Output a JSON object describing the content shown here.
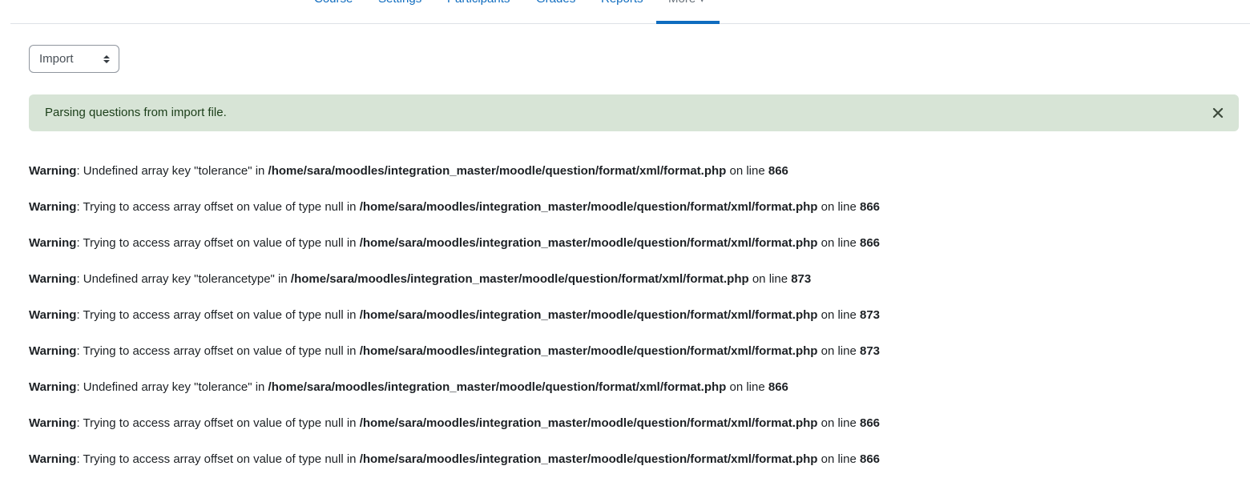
{
  "secondary_nav": {
    "tabs": [
      {
        "label": "Course"
      },
      {
        "label": "Settings"
      },
      {
        "label": "Participants"
      },
      {
        "label": "Grades"
      },
      {
        "label": "Reports"
      },
      {
        "label": "More ▾"
      }
    ],
    "active_tab": "More"
  },
  "question_bank_select": {
    "value": "Import",
    "icon": "sort-arrows-icon"
  },
  "alert": {
    "message": "Parsing questions from import file.",
    "close_icon": "close-icon",
    "background_color": "#d7e4d6"
  },
  "warnings": [
    {
      "label": "Warning",
      "text": ": Undefined array key \"tolerance\" in ",
      "file": "/home/sara/moodles/integration_master/moodle/question/format/xml/format.php",
      "mid": " on line ",
      "line": "866"
    },
    {
      "label": "Warning",
      "text": ": Trying to access array offset on value of type null in ",
      "file": "/home/sara/moodles/integration_master/moodle/question/format/xml/format.php",
      "mid": " on line ",
      "line": "866"
    },
    {
      "label": "Warning",
      "text": ": Trying to access array offset on value of type null in ",
      "file": "/home/sara/moodles/integration_master/moodle/question/format/xml/format.php",
      "mid": " on line ",
      "line": "866"
    },
    {
      "label": "Warning",
      "text": ": Undefined array key \"tolerancetype\" in ",
      "file": "/home/sara/moodles/integration_master/moodle/question/format/xml/format.php",
      "mid": " on line ",
      "line": "873"
    },
    {
      "label": "Warning",
      "text": ": Trying to access array offset on value of type null in ",
      "file": "/home/sara/moodles/integration_master/moodle/question/format/xml/format.php",
      "mid": " on line ",
      "line": "873"
    },
    {
      "label": "Warning",
      "text": ": Trying to access array offset on value of type null in ",
      "file": "/home/sara/moodles/integration_master/moodle/question/format/xml/format.php",
      "mid": " on line ",
      "line": "873"
    },
    {
      "label": "Warning",
      "text": ": Undefined array key \"tolerance\" in ",
      "file": "/home/sara/moodles/integration_master/moodle/question/format/xml/format.php",
      "mid": " on line ",
      "line": "866"
    },
    {
      "label": "Warning",
      "text": ": Trying to access array offset on value of type null in ",
      "file": "/home/sara/moodles/integration_master/moodle/question/format/xml/format.php",
      "mid": " on line ",
      "line": "866"
    },
    {
      "label": "Warning",
      "text": ": Trying to access array offset on value of type null in ",
      "file": "/home/sara/moodles/integration_master/moodle/question/format/xml/format.php",
      "mid": " on line ",
      "line": "866"
    }
  ]
}
